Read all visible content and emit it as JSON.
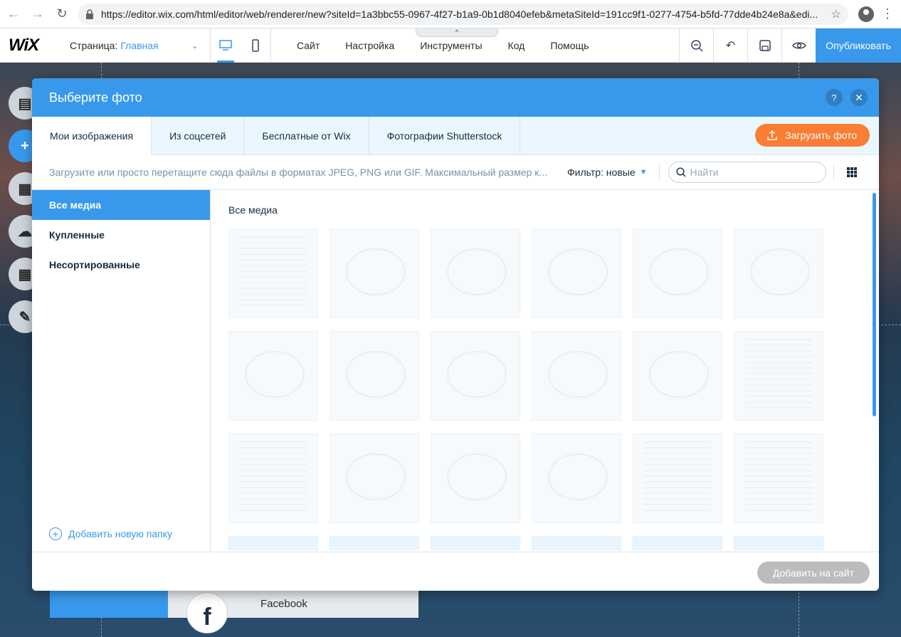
{
  "browser": {
    "url": "https://editor.wix.com/html/editor/web/renderer/new?siteId=1a3bbc55-0967-4f27-b1a9-0b1d8040efeb&metaSiteId=191cc9f1-0277-4754-b5fd-77dde4b24e8a&edi..."
  },
  "wix": {
    "logo": "WiX",
    "page_label": "Страница:",
    "page_name": "Главная",
    "menu": [
      "Сайт",
      "Настройка",
      "Инструменты",
      "Код",
      "Помощь"
    ],
    "publish_label": "Опубликовать",
    "tab_handle": "^"
  },
  "background": {
    "facebook_label": "Facebook",
    "facebook_glyph": "f"
  },
  "dialog": {
    "title": "Выберите фото",
    "help_glyph": "?",
    "close_glyph": "✕",
    "tabs": [
      "Мои изображения",
      "Из соцсетей",
      "Бесплатные от Wix",
      "Фотографии Shutterstock"
    ],
    "upload_label": "Загрузить фото",
    "hint": "Загрузите или просто перетащите сюда файлы в форматах JPEG, PNG или GIF. Максимальный размер к...",
    "filter_label": "Фильтр: новые",
    "search_placeholder": "Найти",
    "sidebar": [
      "Все медиа",
      "Купленные",
      "Несортированные"
    ],
    "add_folder_label": "Добавить новую папку",
    "content_title": "Все медиа",
    "add_to_site_label": "Добавить на сайт"
  },
  "colors": {
    "accent": "#3899ec",
    "upload": "#fb7d33",
    "disabled_button": "#bcbcbc"
  }
}
